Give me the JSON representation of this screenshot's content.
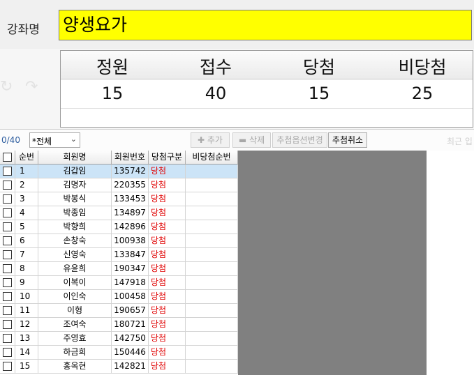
{
  "course": {
    "label": "강좌명",
    "value": "양생요가"
  },
  "stats": {
    "headers": [
      "정원",
      "접수",
      "당첨",
      "비당첨"
    ],
    "values": [
      "15",
      "40",
      "15",
      "25"
    ]
  },
  "toolbar": {
    "count": "0/40",
    "filter_value": "*전체",
    "add_label": "추가",
    "delete_label": "삭제",
    "change_option_label": "추첨옵션변경",
    "cancel_draw_label": "추첨취소",
    "right_hint": "최근 입"
  },
  "grid": {
    "columns": [
      "순번",
      "회원명",
      "회원번호",
      "당첨구분",
      "비당첨순번"
    ],
    "rows": [
      {
        "no": "1",
        "name": "김갑임",
        "member_no": "135742",
        "status": "당첨",
        "nonwin_no": ""
      },
      {
        "no": "2",
        "name": "김명자",
        "member_no": "220355",
        "status": "당첨",
        "nonwin_no": ""
      },
      {
        "no": "3",
        "name": "박봉식",
        "member_no": "133453",
        "status": "당첨",
        "nonwin_no": ""
      },
      {
        "no": "4",
        "name": "박종임",
        "member_no": "134897",
        "status": "당첨",
        "nonwin_no": ""
      },
      {
        "no": "5",
        "name": "박향희",
        "member_no": "142896",
        "status": "당첨",
        "nonwin_no": ""
      },
      {
        "no": "6",
        "name": "손창숙",
        "member_no": "100938",
        "status": "당첨",
        "nonwin_no": ""
      },
      {
        "no": "7",
        "name": "신영숙",
        "member_no": "133847",
        "status": "당첨",
        "nonwin_no": ""
      },
      {
        "no": "8",
        "name": "유윤희",
        "member_no": "190347",
        "status": "당첨",
        "nonwin_no": ""
      },
      {
        "no": "9",
        "name": "이복이",
        "member_no": "147918",
        "status": "당첨",
        "nonwin_no": ""
      },
      {
        "no": "10",
        "name": "이인숙",
        "member_no": "100458",
        "status": "당첨",
        "nonwin_no": ""
      },
      {
        "no": "11",
        "name": "이형",
        "member_no": "190657",
        "status": "당첨",
        "nonwin_no": ""
      },
      {
        "no": "12",
        "name": "조여숙",
        "member_no": "180721",
        "status": "당첨",
        "nonwin_no": ""
      },
      {
        "no": "13",
        "name": "주영효",
        "member_no": "142750",
        "status": "당첨",
        "nonwin_no": ""
      },
      {
        "no": "14",
        "name": "하금희",
        "member_no": "150446",
        "status": "당첨",
        "nonwin_no": ""
      },
      {
        "no": "15",
        "name": "홍옥현",
        "member_no": "142821",
        "status": "당첨",
        "nonwin_no": ""
      }
    ]
  },
  "colors": {
    "highlight": "#ffff00",
    "win": "#e00000",
    "selected_row": "#cce4f7"
  }
}
